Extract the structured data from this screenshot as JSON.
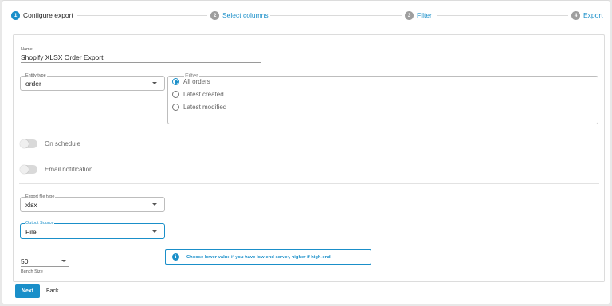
{
  "stepper": {
    "steps": [
      {
        "num": "1",
        "label": "Configure export"
      },
      {
        "num": "2",
        "label": "Select columns"
      },
      {
        "num": "3",
        "label": "Filter"
      },
      {
        "num": "4",
        "label": "Export"
      }
    ],
    "active_step": 1,
    "accent_color": "#1a8fc9"
  },
  "form": {
    "name": {
      "label": "Name",
      "value": "Shopify XLSX Order Export"
    },
    "entity_type": {
      "label": "Entity type",
      "value": "order"
    },
    "filter": {
      "legend": "Filter",
      "options": [
        "All orders",
        "Latest created",
        "Latest modified"
      ],
      "selected": "All orders"
    },
    "on_schedule": {
      "label": "On schedule",
      "enabled": false
    },
    "email_notification": {
      "label": "Email notification",
      "enabled": false
    },
    "export_file_type": {
      "label": "Export file type",
      "value": "xlsx"
    },
    "output_source": {
      "label": "Output Source",
      "value": "File"
    },
    "bunch_size": {
      "label": "Bunch Size",
      "value": "50"
    },
    "info_text": "Choose lower value if you have low-end server, higher if high-end"
  },
  "actions": {
    "next_label": "Next",
    "back_label": "Back"
  }
}
